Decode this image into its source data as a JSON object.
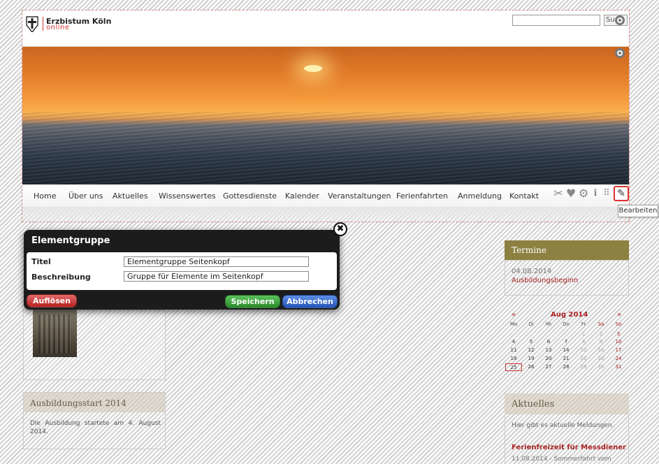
{
  "header": {
    "logo_title": "Erzbistum Köln",
    "logo_sub": "online",
    "search_value": "",
    "search_button": "Su"
  },
  "nav": {
    "items": [
      "Home",
      "Über uns",
      "Aktuelles",
      "Wissenswertes",
      "Gottesdienste",
      "Kalender",
      "Veranstaltungen",
      "Ferienfahrten",
      "Anmeldung",
      "Kontakt"
    ]
  },
  "toolbar": {
    "icons": [
      "scissors-icon",
      "heart-icon",
      "gear-icon",
      "info-icon",
      "grid-icon",
      "pencil-icon"
    ],
    "tooltip": "Bearbeiten"
  },
  "dialog": {
    "title": "Elementgruppe",
    "fields": [
      {
        "label": "Titel",
        "value": "Elementgruppe Seitenkopf"
      },
      {
        "label": "Beschreibung",
        "value": "Gruppe für Elemente im Seitenkopf"
      }
    ],
    "dissolve_label": "Auflösen",
    "save_label": "Speichern",
    "cancel_label": "Abbrechen"
  },
  "news": {
    "title": "Ausbildungsstart 2014",
    "text": "Die Ausbildung startete am 4. August 2014."
  },
  "termine": {
    "title": "Termine",
    "date": "04.08.2014",
    "link": "Ausbildungsbeginn"
  },
  "calendar": {
    "prev": "«",
    "next": "»",
    "month": "Aug 2014",
    "weekdays": [
      "Mo",
      "Di",
      "Mi",
      "Do",
      "Fr",
      "Sa",
      "So"
    ],
    "weeks": [
      [
        "",
        "",
        "",
        "",
        "1",
        "2",
        "3"
      ],
      [
        "4",
        "5",
        "6",
        "7",
        "8",
        "9",
        "10"
      ],
      [
        "11",
        "12",
        "13",
        "14",
        "15",
        "16",
        "17"
      ],
      [
        "18",
        "19",
        "20",
        "21",
        "22",
        "23",
        "24"
      ],
      [
        "25",
        "26",
        "27",
        "28",
        "29",
        "30",
        "31"
      ]
    ],
    "today": "25"
  },
  "aktuelles": {
    "title": "Aktuelles",
    "text": "Hier gibt es aktuelle Meldungen.",
    "link": "Ferienfreizeit für Messdiener",
    "date": "11.08.2014 - Sommerfahrt vom"
  },
  "colors": {
    "accent_red": "#aa2222",
    "termine_olive": "#8c8140",
    "save_green": "#2c8a2c",
    "cancel_blue": "#2554b8"
  }
}
